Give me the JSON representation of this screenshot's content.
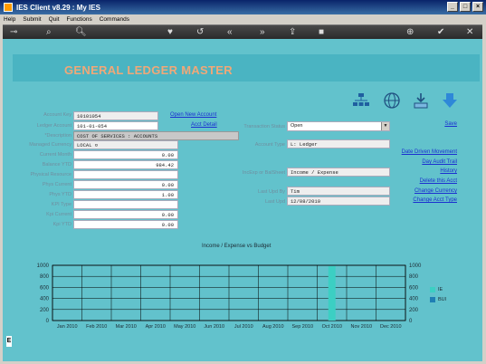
{
  "window": {
    "title": "IES Client v8.29 : My IES"
  },
  "menu": [
    "Help",
    "Submit",
    "Quit",
    "Functions",
    "Commands"
  ],
  "toolbar": {
    "icons": [
      "key-icon",
      "search-icon",
      "heart-icon",
      "undo-icon",
      "rewind-icon",
      "fast-forward-icon",
      "export-icon",
      "stop-icon",
      "plus-icon",
      "check-icon",
      "close-icon"
    ]
  },
  "page": {
    "title": "GENERAL LEDGER MASTER"
  },
  "form": {
    "account_key": {
      "label": "Account Key",
      "value": "10101054"
    },
    "ledger_account": {
      "label": "Ledger Account",
      "value": "101-01-054"
    },
    "description": {
      "label": "*Description",
      "value": "COST OF SERVICES : ACCOUNTS"
    },
    "managed_currency": {
      "label": "Managed Currency",
      "value": "LOCAL ¤"
    },
    "current_month": {
      "label": "Current Month",
      "value": "0.00"
    },
    "balance_ytd": {
      "label": "Balance YTD",
      "value": "984.42"
    },
    "physical_resource": {
      "label": "Physical Resource",
      "value": ""
    },
    "phys_current": {
      "label": "Phys Current",
      "value": "0.00"
    },
    "phys_ytd": {
      "label": "Phys YTD",
      "value": "1.00"
    },
    "kpi_type": {
      "label": "KPI Type",
      "value": ""
    },
    "kpi_current": {
      "label": "Kpi Current",
      "value": "0.00"
    },
    "kpi_ytd": {
      "label": "Kpi YTD",
      "value": "0.00"
    },
    "transaction_status": {
      "label": "Transaction Status",
      "value": "Open"
    },
    "account_type": {
      "label": "Account Type",
      "value": "L: Ledger"
    },
    "inc_exp_or_bal_sheet": {
      "label": "IncExp or BalSheet",
      "value": "Income / Expense"
    },
    "last_upd_by": {
      "label": "Last Upd By",
      "value": "Tim"
    },
    "last_upd": {
      "label": "Last Upd",
      "value": "12/08/2010"
    }
  },
  "links": {
    "open_new_account": "Open New Account",
    "acct_detail": "Acct Detail",
    "save": "Save",
    "date_driven_movement": "Date Driven Movement",
    "day_audit_trail": "Day Audit Trail",
    "history": "History",
    "delete_this_acct": "Delete this Acct",
    "change_currency": "Change Currency",
    "change_acct_type": "Change Acct Type"
  },
  "header_icons": [
    "org-chart-icon",
    "globe-icon",
    "download-tray-icon",
    "down-arrow-icon"
  ],
  "colors": {
    "actual": "#3ccfc3",
    "budget": "#1f7fb4",
    "grid": "#000000",
    "title": "#f0a878"
  },
  "chart_data": {
    "type": "bar",
    "title": "Income / Expense vs Budget",
    "categories": [
      "Jan 2010",
      "Feb 2010",
      "Mar 2010",
      "Apr 2010",
      "May 2010",
      "Jun 2010",
      "Jul 2010",
      "Aug 2010",
      "Sep 2010",
      "Oct 2010",
      "Nov 2010",
      "Dec 2010"
    ],
    "series": [
      {
        "name": "IE",
        "values": [
          0,
          0,
          0,
          0,
          0,
          0,
          0,
          0,
          0,
          984,
          0,
          0
        ]
      },
      {
        "name": "BUI",
        "values": [
          0,
          0,
          0,
          0,
          0,
          0,
          0,
          0,
          0,
          0,
          0,
          0
        ]
      }
    ],
    "ylim": [
      0,
      1000
    ],
    "yticks": [
      0,
      200,
      400,
      600,
      800,
      1000
    ],
    "grid": true,
    "legend": "right"
  }
}
